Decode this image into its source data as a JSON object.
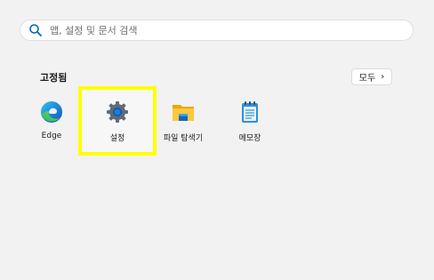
{
  "search": {
    "placeholder": "앱, 설정 및 문서 검색",
    "icon": "search-icon"
  },
  "pinned": {
    "title": "고정됨",
    "all_button_label": "모두",
    "all_button_chevron": "›"
  },
  "apps": [
    {
      "label": "Edge",
      "icon": "edge-icon"
    },
    {
      "label": "설정",
      "icon": "gear-icon"
    },
    {
      "label": "파일 탐색기",
      "icon": "folder-icon"
    },
    {
      "label": "메모장",
      "icon": "notepad-icon"
    }
  ],
  "colors": {
    "background": "#f2f2f2",
    "highlight": "#ffff00",
    "accent": "#0067c0"
  }
}
